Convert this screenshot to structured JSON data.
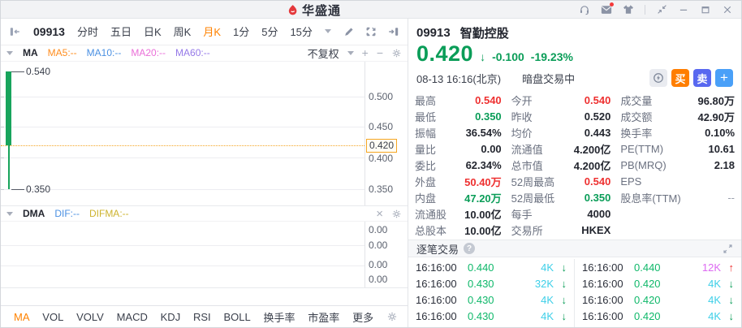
{
  "topbar": {
    "app_name": "华盛通",
    "icons": [
      "customer-service",
      "messages",
      "theme-shop",
      "dock-window",
      "minimize",
      "maximize",
      "close"
    ],
    "has_unread_message": true
  },
  "left": {
    "stock_code": "09913",
    "period_tabs": [
      "分时",
      "五日",
      "日K",
      "周K",
      "月K",
      "1分",
      "5分",
      "15分"
    ],
    "active_period": "月K",
    "overlay": {
      "name": "MA",
      "ma5": "MA5:--",
      "ma10": "MA10:--",
      "ma20": "MA20:--",
      "ma60": "MA60:--",
      "adjust": "不复权"
    },
    "main_chart": {
      "high": "0.540",
      "low": "0.350",
      "current": "0.420",
      "y_axis": [
        "0.500",
        "0.450",
        "0.420",
        "0.400",
        "0.350"
      ]
    },
    "dma": {
      "name": "DMA",
      "dif": "DIF:--",
      "difma": "DIFMA:--",
      "y_axis": [
        "0.00",
        "0.00",
        "0.00",
        "0.00"
      ]
    },
    "indicator_tabs": [
      "MA",
      "VOL",
      "VOLV",
      "MACD",
      "KDJ",
      "RSI",
      "BOLL",
      "换手率",
      "市盈率",
      "更多"
    ],
    "active_indicator": "MA"
  },
  "right": {
    "code": "09913",
    "name": "智勤控股",
    "price": "0.420",
    "change": "-0.100",
    "change_pct": "-19.23%",
    "datetime": "08-13 16:16(北京)",
    "session_status": "暗盘交易中",
    "buy_label": "买",
    "sell_label": "卖",
    "add_label": "+",
    "stats": [
      {
        "l1": "最高",
        "v1": "0.540",
        "l2": "今开",
        "v2": "0.540",
        "l3": "成交量",
        "v3": "96.80万"
      },
      {
        "l1": "最低",
        "v1": "0.350",
        "l2": "昨收",
        "v2": "0.520",
        "l3": "成交额",
        "v3": "42.90万"
      },
      {
        "l1": "振幅",
        "v1": "36.54%",
        "l2": "均价",
        "v2": "0.443",
        "l3": "换手率",
        "v3": "0.10%"
      },
      {
        "l1": "量比",
        "v1": "0.00",
        "l2": "流通值",
        "v2": "4.200亿",
        "l3": "PE(TTM)",
        "v3": "10.61"
      },
      {
        "l1": "委比",
        "v1": "62.34%",
        "l2": "总市值",
        "v2": "4.200亿",
        "l3": "PB(MRQ)",
        "v3": "2.18"
      },
      {
        "l1": "外盘",
        "v1": "50.40万",
        "l2": "52周最高",
        "v2": "0.540",
        "l3": "EPS",
        "v3": ""
      },
      {
        "l1": "内盘",
        "v1": "47.20万",
        "l2": "52周最低",
        "v2": "0.350",
        "l3": "股息率(TTM)",
        "v3": "--"
      },
      {
        "l1": "流通股",
        "v1": "10.00亿",
        "l2": "每手",
        "v2": "4000",
        "l3": "",
        "v3": ""
      },
      {
        "l1": "总股本",
        "v1": "10.00亿",
        "l2": "交易所",
        "v2": "HKEX",
        "l3": "",
        "v3": ""
      }
    ],
    "trades_title": "逐笔交易",
    "trades_left": [
      {
        "time": "16:16:00",
        "price": "0.440",
        "volume": "4K",
        "direction": "down"
      },
      {
        "time": "16:16:00",
        "price": "0.430",
        "volume": "32K",
        "direction": "down"
      },
      {
        "time": "16:16:00",
        "price": "0.430",
        "volume": "4K",
        "direction": "down"
      },
      {
        "time": "16:16:00",
        "price": "0.430",
        "volume": "4K",
        "direction": "down"
      }
    ],
    "trades_right": [
      {
        "time": "16:16:00",
        "price": "0.440",
        "volume": "12K",
        "direction": "up"
      },
      {
        "time": "16:16:00",
        "price": "0.420",
        "volume": "4K",
        "direction": "down"
      },
      {
        "time": "16:16:00",
        "price": "0.420",
        "volume": "4K",
        "direction": "down"
      },
      {
        "time": "16:16:00",
        "price": "0.420",
        "volume": "4K",
        "direction": "down"
      }
    ]
  },
  "colors": {
    "up_red": "#ee3030",
    "down_green": "#0a9d58",
    "accent_orange": "#ff8200",
    "buy_button": "#ff7e00",
    "sell_button": "#5868f0",
    "add_button": "#4aa0f8",
    "volume_cyan": "#3ecfe8",
    "volume_magenta": "#dd6af2"
  },
  "chart_data": {
    "type": "candlestick",
    "title": "09913 月K",
    "candles": [
      {
        "open": 0.54,
        "high": 0.54,
        "low": 0.35,
        "close": 0.42
      }
    ],
    "y_axis_ticks": [
      0.5,
      0.45,
      0.42,
      0.4,
      0.35
    ],
    "current_price": 0.42,
    "ylim": [
      0.33,
      0.56
    ],
    "grid": true
  }
}
